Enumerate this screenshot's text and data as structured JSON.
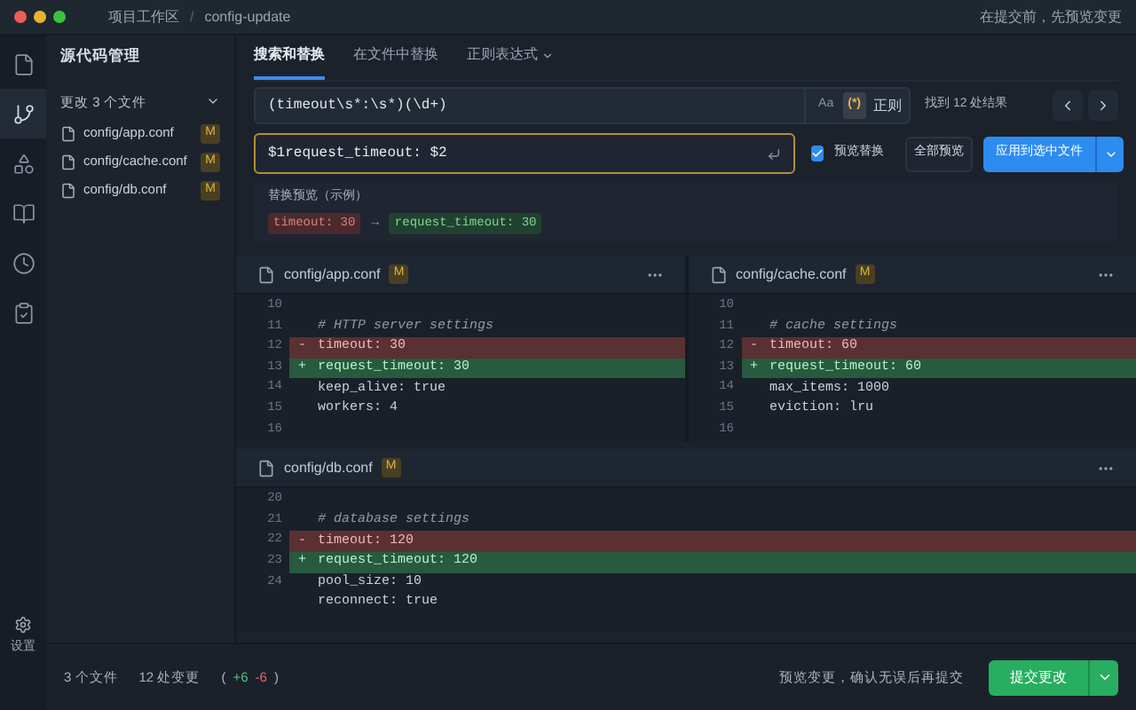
{
  "window": {
    "breadcrumb": [
      "项目工作区",
      "config-update"
    ],
    "separator": "/",
    "hint": "在提交前，先预览变更"
  },
  "activity_bar": {
    "items": [
      {
        "kind": "file",
        "selected": false
      },
      {
        "kind": "branch",
        "selected": true
      },
      {
        "kind": "shapes",
        "selected": false
      },
      {
        "kind": "book",
        "selected": false
      },
      {
        "kind": "clock",
        "selected": false
      },
      {
        "kind": "clipboard",
        "selected": false
      }
    ],
    "settings_label": "设置"
  },
  "sidebar": {
    "title": "源代码管理",
    "group": {
      "label": "更改 3 个文件",
      "expanded": true
    },
    "files": [
      {
        "name": "config/app.conf",
        "status": "M"
      },
      {
        "name": "config/cache.conf",
        "status": "M"
      },
      {
        "name": "config/db.conf",
        "status": "M"
      }
    ]
  },
  "tabs": [
    {
      "label": "搜索和替换",
      "selected": true
    },
    {
      "label": "在文件中替换",
      "selected": false
    },
    {
      "label": "正则表达式",
      "selected": false,
      "dropdown": true
    }
  ],
  "search": {
    "value": "(timeout\\s*:\\s*)(\\d+)",
    "options": [
      {
        "label": "Aa",
        "selected": false
      },
      {
        "label": "(*)",
        "selected": true
      }
    ],
    "mode_label": "正则",
    "result": "找到 12 处结果"
  },
  "replace": {
    "value": "$1request_timeout: $2",
    "preview_label": "预览替换",
    "preview_checked": true,
    "preview_all": "全部预览",
    "apply": "应用到选中文件"
  },
  "preview": {
    "title": "替换预览（示例）",
    "from": "timeout: 30",
    "arrow": "→",
    "to": "request_timeout: 30"
  },
  "diffs": [
    {
      "file": "config/app.conf",
      "status": "M",
      "lines": [
        {
          "num": "10",
          "kind": "context"
        },
        {
          "num": "11",
          "kind": "comment",
          "text": "# HTTP server settings"
        },
        {
          "num": "12",
          "kind": "removed",
          "sign": "-",
          "text": "timeout: 30"
        },
        {
          "num": "13",
          "kind": "added",
          "sign": "+",
          "text": "request_timeout: 30"
        },
        {
          "num": "14",
          "kind": "context",
          "text": "keep_alive: true"
        },
        {
          "num": "15",
          "kind": "context",
          "text": "workers: 4"
        },
        {
          "num": "16",
          "kind": "context"
        }
      ]
    },
    {
      "file": "config/cache.conf",
      "status": "M",
      "lines": [
        {
          "num": "10",
          "kind": "context"
        },
        {
          "num": "11",
          "kind": "comment",
          "text": "# cache settings"
        },
        {
          "num": "12",
          "kind": "removed",
          "sign": "-",
          "text": "timeout: 60"
        },
        {
          "num": "13",
          "kind": "added",
          "sign": "+",
          "text": "request_timeout: 60"
        },
        {
          "num": "14",
          "kind": "context",
          "text": "max_items: 1000"
        },
        {
          "num": "15",
          "kind": "context",
          "text": "eviction: lru"
        },
        {
          "num": "16",
          "kind": "context"
        }
      ]
    },
    {
      "file": "config/db.conf",
      "status": "M",
      "lines": [
        {
          "num": "20",
          "kind": "context"
        },
        {
          "num": "21",
          "kind": "comment",
          "text": "# database settings"
        },
        {
          "num": "22",
          "kind": "removed",
          "sign": "-",
          "text": "timeout: 120"
        },
        {
          "num": "23",
          "kind": "added",
          "sign": "+",
          "text": "request_timeout: 120"
        },
        {
          "num": "24",
          "kind": "context",
          "text": "pool_size: 10"
        },
        {
          "kind": "context",
          "text": "reconnect: true"
        }
      ]
    }
  ],
  "status_bar": {
    "files": "3 个文件",
    "changes": "12 处变更",
    "open": "(",
    "added": "+6",
    "removed": "-6",
    "close": ")",
    "hint": "预览变更，确认无误后再提交",
    "commit": "提交更改"
  }
}
